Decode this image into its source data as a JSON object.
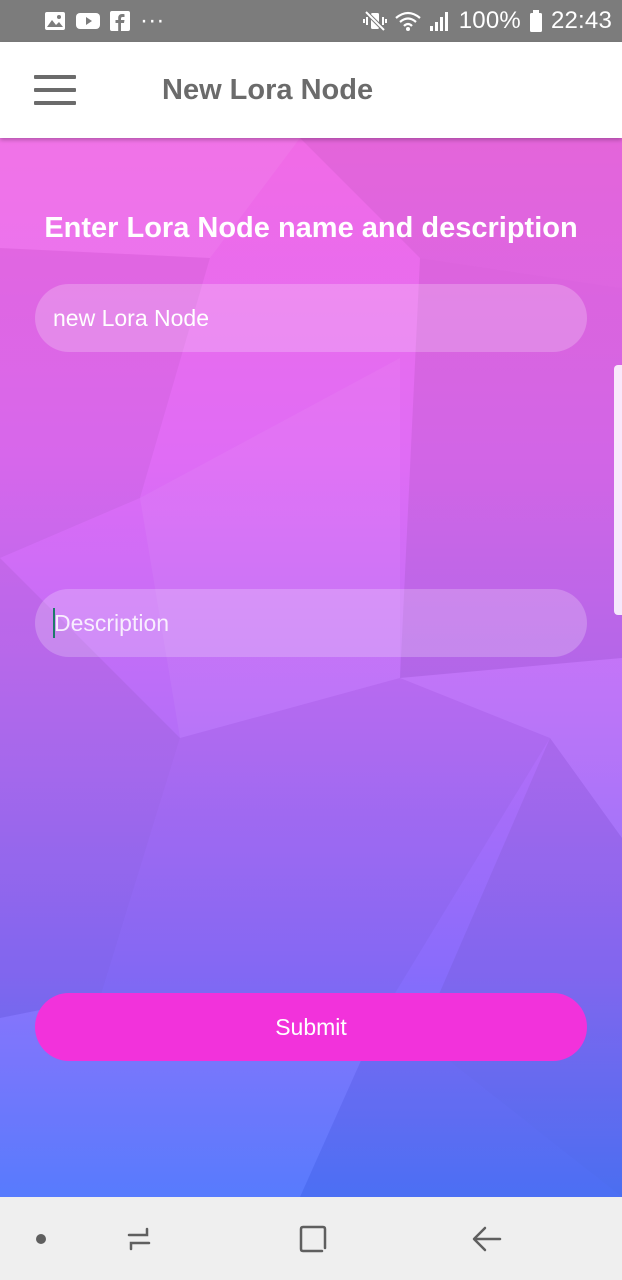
{
  "status_bar": {
    "icons_left": [
      "gallery-icon",
      "youtube-icon",
      "facebook-icon",
      "more-dots-icon"
    ],
    "more_dots": "···",
    "battery": "100%",
    "time": "22:43",
    "icons_right": [
      "mute-vibrate-icon",
      "wifi-icon",
      "signal-icon",
      "battery-icon"
    ]
  },
  "app_bar": {
    "title": "New Lora Node",
    "menu_icon": "hamburger-menu-icon"
  },
  "main": {
    "prompt": "Enter Lora Node name and description",
    "name_field": {
      "value": "new Lora Node"
    },
    "description_field": {
      "value": "",
      "placeholder": "Description"
    },
    "submit_label": "Submit"
  },
  "nav_bar": {
    "items": [
      "dot-icon",
      "recent-apps-icon",
      "home-icon",
      "back-icon"
    ]
  },
  "colors": {
    "accent": "#f232db",
    "gradient_top": "#f16be6",
    "gradient_bottom": "#4f74fd",
    "appbar_text": "#6b6b6b",
    "status_bar_bg": "#7c7c7c"
  }
}
